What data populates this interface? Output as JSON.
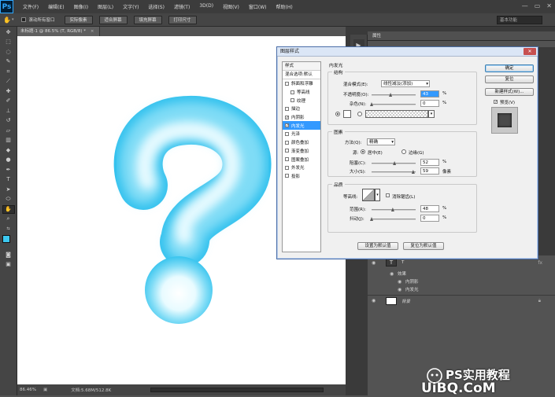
{
  "app": {
    "logo": "Ps",
    "menus": [
      "文件(F)",
      "编辑(E)",
      "图像(I)",
      "图层(L)",
      "文字(Y)",
      "选择(S)",
      "滤镜(T)",
      "3D(D)",
      "视图(V)",
      "窗口(W)",
      "帮助(H)"
    ],
    "window_controls": [
      "—",
      "▭",
      "✕"
    ]
  },
  "options_bar": {
    "scroll_all_label": "滚动所有窗口",
    "buttons": [
      "实际像素",
      "适合屏幕",
      "填充屏幕",
      "打印尺寸"
    ],
    "workspace": "基本功能"
  },
  "document": {
    "tab_title": "未标题-1 @ 86.5% (T, RGB/8) *",
    "close": "×",
    "zoom": "86.46%",
    "doc_size": "文档:5.68M/512.8K",
    "glyph_color": "#3cc8f0",
    "glyph_highlight": "#eefcff"
  },
  "panels": {
    "properties_title": "属性"
  },
  "layers": {
    "text_layer_name": "T",
    "effects_label": "效果",
    "effect_inner_shadow": "内阴影",
    "effect_inner_glow": "内发光",
    "background_name": "背景",
    "fx": "fx"
  },
  "dialog": {
    "title": "图层样式",
    "close": "✕",
    "style_list": {
      "header": "样式",
      "blend_default": "混合选项:默认",
      "items": [
        {
          "label": "斜面和浮雕",
          "checked": false,
          "indent": false
        },
        {
          "label": "等高线",
          "checked": false,
          "indent": true
        },
        {
          "label": "纹理",
          "checked": false,
          "indent": true
        },
        {
          "label": "描边",
          "checked": false,
          "indent": false
        },
        {
          "label": "内阴影",
          "checked": true,
          "indent": false
        },
        {
          "label": "内发光",
          "checked": true,
          "indent": false,
          "selected": true
        },
        {
          "label": "光泽",
          "checked": false,
          "indent": false
        },
        {
          "label": "颜色叠加",
          "checked": false,
          "indent": false
        },
        {
          "label": "渐变叠加",
          "checked": false,
          "indent": false
        },
        {
          "label": "图案叠加",
          "checked": false,
          "indent": false
        },
        {
          "label": "外发光",
          "checked": false,
          "indent": false
        },
        {
          "label": "投影",
          "checked": false,
          "indent": false
        }
      ]
    },
    "inner_glow": {
      "title": "内发光",
      "structure": {
        "title": "结构",
        "blend_mode_label": "混合模式(E):",
        "blend_mode_value": "线性减淡(添加)",
        "opacity_label": "不透明度(O):",
        "opacity_value": "43",
        "noise_label": "杂色(N):",
        "noise_value": "0",
        "percent": "%"
      },
      "elements": {
        "title": "图素",
        "method_label": "方法(Q):",
        "method_value": "精确",
        "source_label": "源:",
        "center_label": "居中(E)",
        "edge_label": "边缘(G)",
        "choke_label": "阻塞(C):",
        "choke_value": "52",
        "size_label": "大小(S):",
        "size_value": "59",
        "percent": "%",
        "px_unit": "像素"
      },
      "quality": {
        "title": "品质",
        "contour_label": "等高线:",
        "antialias_label": "消除锯齿(L)",
        "range_label": "范围(R):",
        "range_value": "48",
        "jitter_label": "抖动(J):",
        "jitter_value": "0",
        "percent": "%"
      },
      "make_default": "设置为默认值",
      "reset_default": "复位为默认值"
    },
    "buttons": {
      "ok": "确定",
      "reset": "复位",
      "new_style": "新建样式(W)...",
      "preview": "预览(V)"
    },
    "values": {
      "opacity": 43,
      "noise": 0,
      "choke": 52,
      "size": 59,
      "range": 48,
      "jitter": 0
    }
  },
  "watermark": {
    "site": "UiBQ.CoM",
    "text": "PS实用教程"
  }
}
